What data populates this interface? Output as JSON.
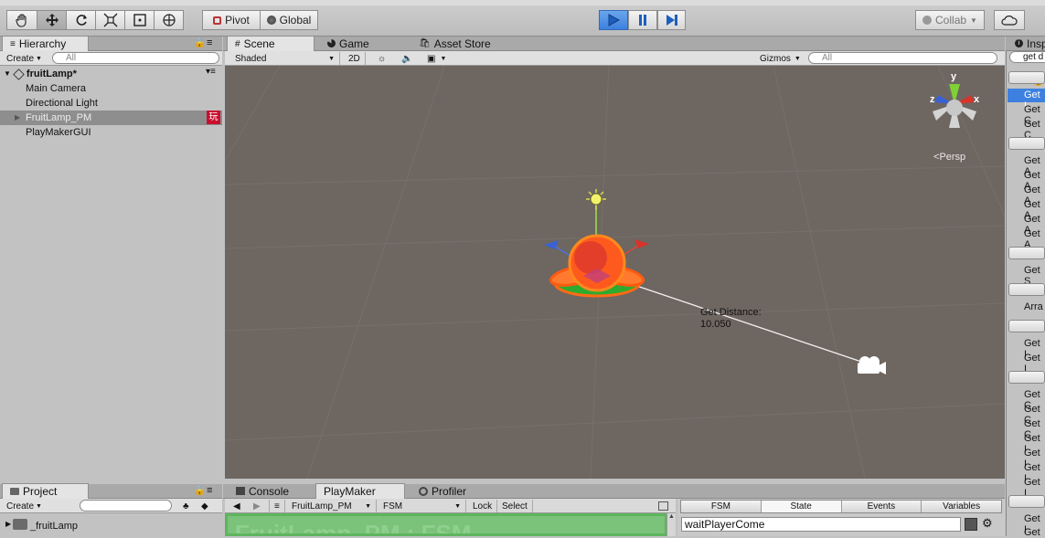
{
  "toolbar": {
    "pivot_label": "Pivot",
    "global_label": "Global",
    "collab_label": "Collab"
  },
  "hierarchy": {
    "tab_label": "Hierarchy",
    "create_label": "Create",
    "search_placeholder": "All",
    "scene_name": "fruitLamp*",
    "items": [
      {
        "label": "Main Camera"
      },
      {
        "label": "Directional Light"
      },
      {
        "label": "FruitLamp_PM",
        "badge": "玩"
      },
      {
        "label": "PlayMakerGUI"
      }
    ]
  },
  "scene": {
    "tabs": [
      {
        "label": "Scene"
      },
      {
        "label": "Game"
      },
      {
        "label": "Asset Store"
      }
    ],
    "shading": "Shaded",
    "mode_2d": "2D",
    "gizmos_label": "Gizmos",
    "search_placeholder": "All",
    "persp_label": "Persp",
    "axis_x": "x",
    "axis_y": "y",
    "axis_z": "z",
    "distance_label": "Get Distance:",
    "distance_value": "10.050"
  },
  "inspector": {
    "tab_label": "Insp",
    "search_value": "get d",
    "items": [
      "Get I",
      "Get C",
      "Get C",
      "Get A",
      "Get A",
      "Get A",
      "Get A",
      "Get A",
      "Get A",
      "Get S",
      "Arra",
      "Get I",
      "Get I",
      "Get C",
      "Get C",
      "Get C",
      "Get I",
      "Get I",
      "Get I",
      "Get I",
      "Get I",
      "Get"
    ]
  },
  "project": {
    "tab_label": "Project",
    "create_label": "Create",
    "folder": "_fruitLamp"
  },
  "bottom": {
    "tabs": [
      {
        "label": "Console"
      },
      {
        "label": "PlayMaker"
      },
      {
        "label": "Profiler"
      }
    ],
    "object": "FruitLamp_PM",
    "fsm": "FSM",
    "lock": "Lock",
    "select": "Select",
    "title_partial": "FruitLamp_PM : FSM",
    "tabs_right": [
      "FSM",
      "State",
      "Events",
      "Variables"
    ],
    "state_name": "waitPlayerCome"
  },
  "colors": {
    "accent": "#3d80df",
    "scene_bg": "#6e6661",
    "lamp": "#ff5a1e"
  }
}
